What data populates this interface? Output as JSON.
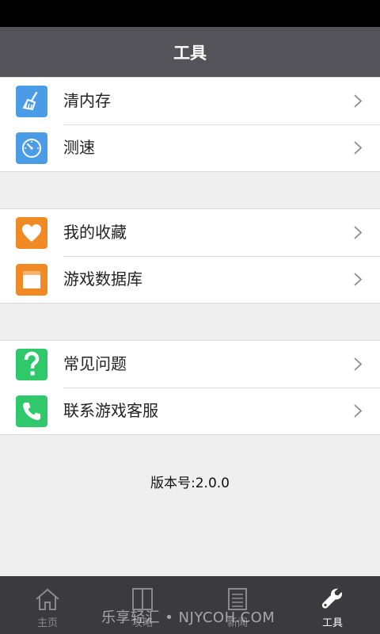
{
  "header": {
    "title": "工具"
  },
  "groups": [
    {
      "items": [
        {
          "label": "清内存",
          "icon": "broom-icon",
          "color": "#4a9ce6"
        },
        {
          "label": "测速",
          "icon": "speedometer-icon",
          "color": "#4a9ce6"
        }
      ]
    },
    {
      "items": [
        {
          "label": "我的收藏",
          "icon": "heart-icon",
          "color": "#f08a24"
        },
        {
          "label": "游戏数据库",
          "icon": "box-icon",
          "color": "#f08a24"
        }
      ]
    },
    {
      "items": [
        {
          "label": "常见问题",
          "icon": "question-icon",
          "color": "#2fc86b"
        },
        {
          "label": "联系游戏客服",
          "icon": "phone-icon",
          "color": "#2fc86b"
        }
      ]
    }
  ],
  "version_text": "版本号:2.0.0",
  "tabs": [
    {
      "label": "主页",
      "icon": "home-icon"
    },
    {
      "label": "攻略",
      "icon": "book-icon"
    },
    {
      "label": "新闻",
      "icon": "news-icon"
    },
    {
      "label": "工具",
      "icon": "wrench-icon",
      "active": true
    }
  ],
  "watermark": "乐享轻汇 • NJYCOH.COM"
}
